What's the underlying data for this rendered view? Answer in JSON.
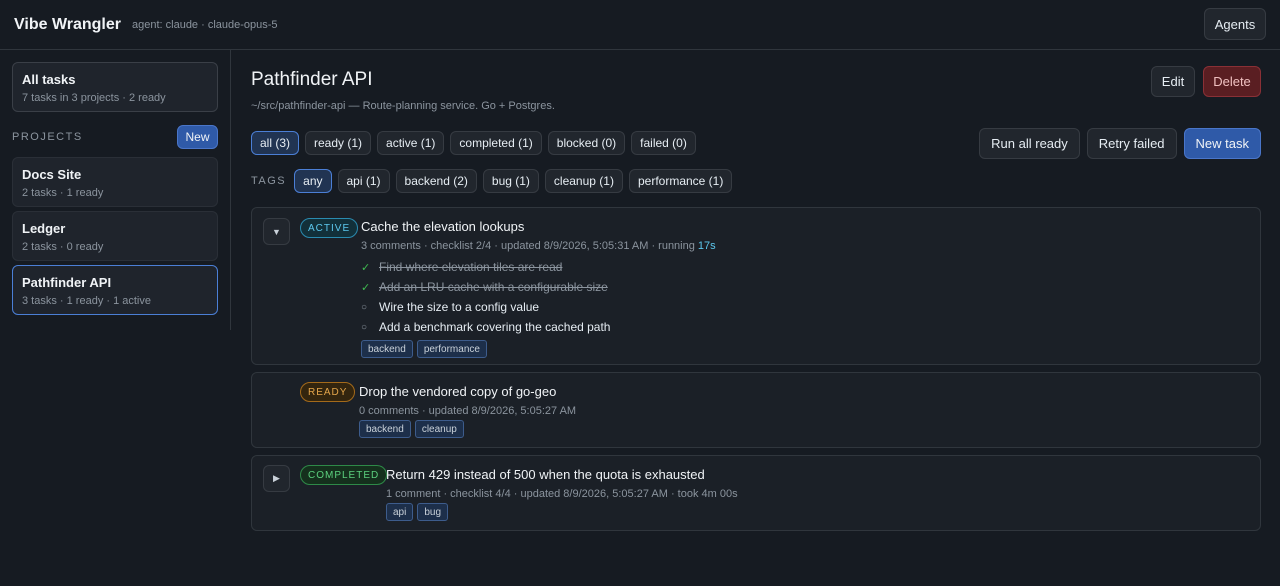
{
  "header": {
    "brand": "Vibe Wrangler",
    "agent_info": "agent: claude · claude-opus-5",
    "agents_button": "Agents"
  },
  "sidebar": {
    "all_tasks": {
      "title": "All tasks",
      "subtitle": "7 tasks in 3 projects · 2 ready"
    },
    "projects_label": "PROJECTS",
    "new_button": "New",
    "projects": [
      {
        "title": "Docs Site",
        "subtitle": "2 tasks · 1 ready"
      },
      {
        "title": "Ledger",
        "subtitle": "2 tasks · 0 ready"
      },
      {
        "title": "Pathfinder API",
        "subtitle": "3 tasks · 1 ready · 1 active",
        "selected": true
      }
    ]
  },
  "project": {
    "title": "Pathfinder API",
    "description": "~/src/pathfinder-api — Route-planning service. Go + Postgres.",
    "edit_button": "Edit",
    "delete_button": "Delete"
  },
  "filters": {
    "status": [
      "all (3)",
      "ready (1)",
      "active (1)",
      "completed (1)",
      "blocked (0)",
      "failed (0)"
    ],
    "selected_status": "all (3)",
    "tags_label": "TAGS",
    "tags": [
      "any",
      "api (1)",
      "backend (2)",
      "bug (1)",
      "cleanup (1)",
      "performance (1)"
    ],
    "selected_tag": "any"
  },
  "actions": {
    "run_all_ready": "Run all ready",
    "retry_failed": "Retry failed",
    "new_task": "New task"
  },
  "tasks": [
    {
      "status": "ACTIVE",
      "toggle": "▼",
      "title": "Cache the elevation lookups",
      "meta": "3 comments · checklist 2/4 · updated 8/9/2026, 5:05:31 AM · running ",
      "meta_highlight": "17s",
      "checklist": [
        {
          "text": "Find where elevation tiles are read",
          "done": true
        },
        {
          "text": "Add an LRU cache with a configurable size",
          "done": true
        },
        {
          "text": "Wire the size to a config value",
          "done": false
        },
        {
          "text": "Add a benchmark covering the cached path",
          "done": false
        }
      ],
      "tags": [
        "backend",
        "performance"
      ]
    },
    {
      "status": "READY",
      "title": "Drop the vendored copy of go-geo",
      "meta": "0 comments · updated 8/9/2026, 5:05:27 AM",
      "tags": [
        "backend",
        "cleanup"
      ]
    },
    {
      "status": "COMPLETED",
      "toggle": "▶",
      "title": "Return 429 instead of 500 when the quota is exhausted",
      "meta": "1 comment · checklist 4/4 · updated 8/9/2026, 5:05:27 AM · took 4m 00s",
      "tags": [
        "api",
        "bug"
      ]
    }
  ],
  "icons": {
    "check": "✓",
    "circle": "○"
  }
}
